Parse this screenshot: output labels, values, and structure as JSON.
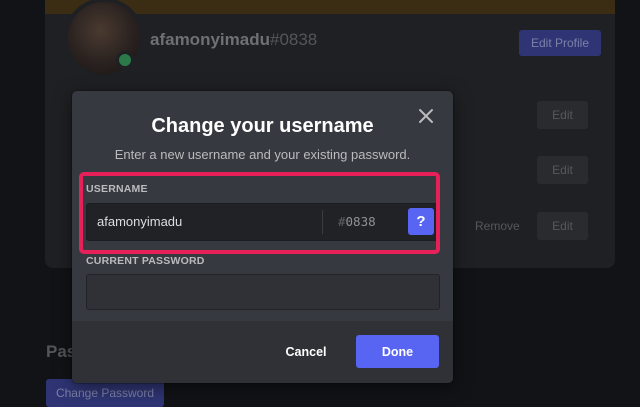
{
  "background": {
    "username": "afamonyimadu",
    "tag": "#0838",
    "edit_profile_label": "Edit Profile",
    "field_edit_label": "Edit",
    "remove_label": "Remove",
    "password_heading": "Pas",
    "change_password_label": "Change Password"
  },
  "modal": {
    "title": "Change your username",
    "subtitle": "Enter a new username and your existing password.",
    "username_label": "USERNAME",
    "username_value": "afamonyimadu",
    "discriminator_hash": "#",
    "discriminator": "0838",
    "help_label": "?",
    "password_label": "CURRENT PASSWORD",
    "password_value": "",
    "cancel_label": "Cancel",
    "done_label": "Done"
  },
  "colors": {
    "accent": "#5865f2",
    "highlight": "#e8205a",
    "modal_bg": "#36393f",
    "footer_bg": "#2f3136"
  }
}
